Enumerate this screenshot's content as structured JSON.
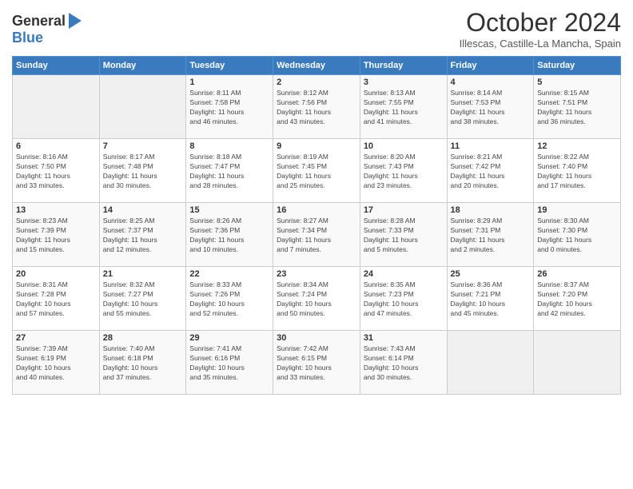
{
  "header": {
    "logo_general": "General",
    "logo_blue": "Blue",
    "month": "October 2024",
    "location": "Illescas, Castille-La Mancha, Spain"
  },
  "weekdays": [
    "Sunday",
    "Monday",
    "Tuesday",
    "Wednesday",
    "Thursday",
    "Friday",
    "Saturday"
  ],
  "weeks": [
    [
      {
        "day": "",
        "info": ""
      },
      {
        "day": "",
        "info": ""
      },
      {
        "day": "1",
        "info": "Sunrise: 8:11 AM\nSunset: 7:58 PM\nDaylight: 11 hours\nand 46 minutes."
      },
      {
        "day": "2",
        "info": "Sunrise: 8:12 AM\nSunset: 7:56 PM\nDaylight: 11 hours\nand 43 minutes."
      },
      {
        "day": "3",
        "info": "Sunrise: 8:13 AM\nSunset: 7:55 PM\nDaylight: 11 hours\nand 41 minutes."
      },
      {
        "day": "4",
        "info": "Sunrise: 8:14 AM\nSunset: 7:53 PM\nDaylight: 11 hours\nand 38 minutes."
      },
      {
        "day": "5",
        "info": "Sunrise: 8:15 AM\nSunset: 7:51 PM\nDaylight: 11 hours\nand 36 minutes."
      }
    ],
    [
      {
        "day": "6",
        "info": "Sunrise: 8:16 AM\nSunset: 7:50 PM\nDaylight: 11 hours\nand 33 minutes."
      },
      {
        "day": "7",
        "info": "Sunrise: 8:17 AM\nSunset: 7:48 PM\nDaylight: 11 hours\nand 30 minutes."
      },
      {
        "day": "8",
        "info": "Sunrise: 8:18 AM\nSunset: 7:47 PM\nDaylight: 11 hours\nand 28 minutes."
      },
      {
        "day": "9",
        "info": "Sunrise: 8:19 AM\nSunset: 7:45 PM\nDaylight: 11 hours\nand 25 minutes."
      },
      {
        "day": "10",
        "info": "Sunrise: 8:20 AM\nSunset: 7:43 PM\nDaylight: 11 hours\nand 23 minutes."
      },
      {
        "day": "11",
        "info": "Sunrise: 8:21 AM\nSunset: 7:42 PM\nDaylight: 11 hours\nand 20 minutes."
      },
      {
        "day": "12",
        "info": "Sunrise: 8:22 AM\nSunset: 7:40 PM\nDaylight: 11 hours\nand 17 minutes."
      }
    ],
    [
      {
        "day": "13",
        "info": "Sunrise: 8:23 AM\nSunset: 7:39 PM\nDaylight: 11 hours\nand 15 minutes."
      },
      {
        "day": "14",
        "info": "Sunrise: 8:25 AM\nSunset: 7:37 PM\nDaylight: 11 hours\nand 12 minutes."
      },
      {
        "day": "15",
        "info": "Sunrise: 8:26 AM\nSunset: 7:36 PM\nDaylight: 11 hours\nand 10 minutes."
      },
      {
        "day": "16",
        "info": "Sunrise: 8:27 AM\nSunset: 7:34 PM\nDaylight: 11 hours\nand 7 minutes."
      },
      {
        "day": "17",
        "info": "Sunrise: 8:28 AM\nSunset: 7:33 PM\nDaylight: 11 hours\nand 5 minutes."
      },
      {
        "day": "18",
        "info": "Sunrise: 8:29 AM\nSunset: 7:31 PM\nDaylight: 11 hours\nand 2 minutes."
      },
      {
        "day": "19",
        "info": "Sunrise: 8:30 AM\nSunset: 7:30 PM\nDaylight: 11 hours\nand 0 minutes."
      }
    ],
    [
      {
        "day": "20",
        "info": "Sunrise: 8:31 AM\nSunset: 7:28 PM\nDaylight: 10 hours\nand 57 minutes."
      },
      {
        "day": "21",
        "info": "Sunrise: 8:32 AM\nSunset: 7:27 PM\nDaylight: 10 hours\nand 55 minutes."
      },
      {
        "day": "22",
        "info": "Sunrise: 8:33 AM\nSunset: 7:26 PM\nDaylight: 10 hours\nand 52 minutes."
      },
      {
        "day": "23",
        "info": "Sunrise: 8:34 AM\nSunset: 7:24 PM\nDaylight: 10 hours\nand 50 minutes."
      },
      {
        "day": "24",
        "info": "Sunrise: 8:35 AM\nSunset: 7:23 PM\nDaylight: 10 hours\nand 47 minutes."
      },
      {
        "day": "25",
        "info": "Sunrise: 8:36 AM\nSunset: 7:21 PM\nDaylight: 10 hours\nand 45 minutes."
      },
      {
        "day": "26",
        "info": "Sunrise: 8:37 AM\nSunset: 7:20 PM\nDaylight: 10 hours\nand 42 minutes."
      }
    ],
    [
      {
        "day": "27",
        "info": "Sunrise: 7:39 AM\nSunset: 6:19 PM\nDaylight: 10 hours\nand 40 minutes."
      },
      {
        "day": "28",
        "info": "Sunrise: 7:40 AM\nSunset: 6:18 PM\nDaylight: 10 hours\nand 37 minutes."
      },
      {
        "day": "29",
        "info": "Sunrise: 7:41 AM\nSunset: 6:16 PM\nDaylight: 10 hours\nand 35 minutes."
      },
      {
        "day": "30",
        "info": "Sunrise: 7:42 AM\nSunset: 6:15 PM\nDaylight: 10 hours\nand 33 minutes."
      },
      {
        "day": "31",
        "info": "Sunrise: 7:43 AM\nSunset: 6:14 PM\nDaylight: 10 hours\nand 30 minutes."
      },
      {
        "day": "",
        "info": ""
      },
      {
        "day": "",
        "info": ""
      }
    ]
  ]
}
